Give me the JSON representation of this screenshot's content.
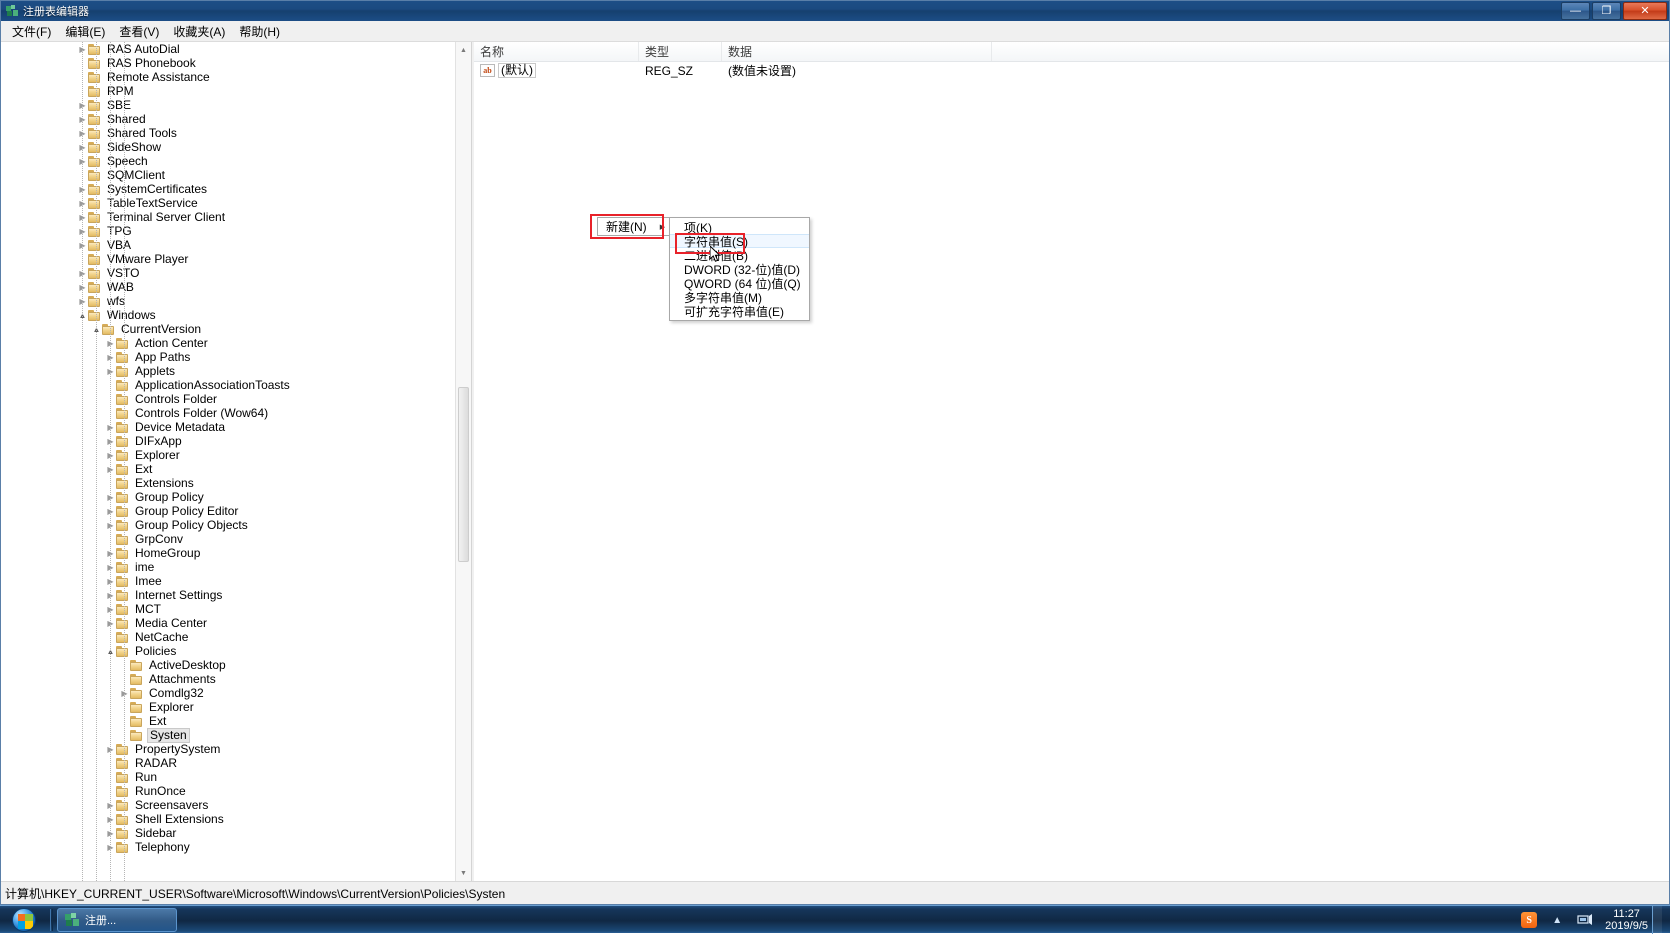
{
  "window": {
    "title": "注册表编辑器",
    "icon": "registry-editor-icon",
    "buttons": {
      "minimize": "—",
      "restore": "❐",
      "close": "✕"
    }
  },
  "menu_bar": {
    "items": [
      {
        "label": "文件(F)",
        "name": "menu-file"
      },
      {
        "label": "编辑(E)",
        "name": "menu-edit"
      },
      {
        "label": "查看(V)",
        "name": "menu-view"
      },
      {
        "label": "收藏夹(A)",
        "name": "menu-favorites"
      },
      {
        "label": "帮助(H)",
        "name": "menu-help"
      }
    ]
  },
  "tree": {
    "items": [
      {
        "label": "RAS AutoDial",
        "depth": 1,
        "state": "collapsed"
      },
      {
        "label": "RAS Phonebook",
        "depth": 1,
        "state": "leaf"
      },
      {
        "label": "Remote Assistance",
        "depth": 1,
        "state": "leaf"
      },
      {
        "label": "RPM",
        "depth": 1,
        "state": "leaf"
      },
      {
        "label": "SBE",
        "depth": 1,
        "state": "collapsed"
      },
      {
        "label": "Shared",
        "depth": 1,
        "state": "collapsed"
      },
      {
        "label": "Shared Tools",
        "depth": 1,
        "state": "collapsed"
      },
      {
        "label": "SideShow",
        "depth": 1,
        "state": "collapsed"
      },
      {
        "label": "Speech",
        "depth": 1,
        "state": "collapsed"
      },
      {
        "label": "SQMClient",
        "depth": 1,
        "state": "leaf"
      },
      {
        "label": "SystemCertificates",
        "depth": 1,
        "state": "collapsed"
      },
      {
        "label": "TableTextService",
        "depth": 1,
        "state": "collapsed"
      },
      {
        "label": "Terminal Server Client",
        "depth": 1,
        "state": "collapsed"
      },
      {
        "label": "TPG",
        "depth": 1,
        "state": "collapsed"
      },
      {
        "label": "VBA",
        "depth": 1,
        "state": "collapsed"
      },
      {
        "label": "VMware Player",
        "depth": 1,
        "state": "leaf"
      },
      {
        "label": "VSTO",
        "depth": 1,
        "state": "collapsed"
      },
      {
        "label": "WAB",
        "depth": 1,
        "state": "collapsed"
      },
      {
        "label": "wfs",
        "depth": 1,
        "state": "collapsed"
      },
      {
        "label": "Windows",
        "depth": 1,
        "state": "expanded"
      },
      {
        "label": "CurrentVersion",
        "depth": 2,
        "state": "expanded"
      },
      {
        "label": "Action Center",
        "depth": 3,
        "state": "collapsed"
      },
      {
        "label": "App Paths",
        "depth": 3,
        "state": "collapsed"
      },
      {
        "label": "Applets",
        "depth": 3,
        "state": "collapsed"
      },
      {
        "label": "ApplicationAssociationToasts",
        "depth": 3,
        "state": "leaf"
      },
      {
        "label": "Controls Folder",
        "depth": 3,
        "state": "leaf"
      },
      {
        "label": "Controls Folder (Wow64)",
        "depth": 3,
        "state": "leaf"
      },
      {
        "label": "Device Metadata",
        "depth": 3,
        "state": "collapsed"
      },
      {
        "label": "DIFxApp",
        "depth": 3,
        "state": "collapsed"
      },
      {
        "label": "Explorer",
        "depth": 3,
        "state": "collapsed"
      },
      {
        "label": "Ext",
        "depth": 3,
        "state": "collapsed"
      },
      {
        "label": "Extensions",
        "depth": 3,
        "state": "leaf"
      },
      {
        "label": "Group Policy",
        "depth": 3,
        "state": "collapsed"
      },
      {
        "label": "Group Policy Editor",
        "depth": 3,
        "state": "collapsed"
      },
      {
        "label": "Group Policy Objects",
        "depth": 3,
        "state": "collapsed"
      },
      {
        "label": "GrpConv",
        "depth": 3,
        "state": "leaf"
      },
      {
        "label": "HomeGroup",
        "depth": 3,
        "state": "collapsed"
      },
      {
        "label": "ime",
        "depth": 3,
        "state": "collapsed"
      },
      {
        "label": "Imee",
        "depth": 3,
        "state": "collapsed"
      },
      {
        "label": "Internet Settings",
        "depth": 3,
        "state": "collapsed"
      },
      {
        "label": "MCT",
        "depth": 3,
        "state": "collapsed"
      },
      {
        "label": "Media Center",
        "depth": 3,
        "state": "collapsed"
      },
      {
        "label": "NetCache",
        "depth": 3,
        "state": "leaf"
      },
      {
        "label": "Policies",
        "depth": 3,
        "state": "expanded"
      },
      {
        "label": "ActiveDesktop",
        "depth": 4,
        "state": "leaf"
      },
      {
        "label": "Attachments",
        "depth": 4,
        "state": "leaf"
      },
      {
        "label": "Comdlg32",
        "depth": 4,
        "state": "collapsed"
      },
      {
        "label": "Explorer",
        "depth": 4,
        "state": "leaf"
      },
      {
        "label": "Ext",
        "depth": 4,
        "state": "leaf"
      },
      {
        "label": "Systen",
        "depth": 4,
        "state": "leaf",
        "selected": true
      },
      {
        "label": "PropertySystem",
        "depth": 3,
        "state": "collapsed"
      },
      {
        "label": "RADAR",
        "depth": 3,
        "state": "leaf"
      },
      {
        "label": "Run",
        "depth": 3,
        "state": "leaf"
      },
      {
        "label": "RunOnce",
        "depth": 3,
        "state": "leaf"
      },
      {
        "label": "Screensavers",
        "depth": 3,
        "state": "collapsed"
      },
      {
        "label": "Shell Extensions",
        "depth": 3,
        "state": "collapsed"
      },
      {
        "label": "Sidebar",
        "depth": 3,
        "state": "collapsed"
      },
      {
        "label": "Telephony",
        "depth": 3,
        "state": "collapsed"
      }
    ],
    "scrollbar": {
      "up_arrow": "▲",
      "down_arrow": "▼"
    }
  },
  "value_list": {
    "columns": [
      {
        "label": "名称",
        "name": "column-name"
      },
      {
        "label": "类型",
        "name": "column-type"
      },
      {
        "label": "数据",
        "name": "column-data"
      }
    ],
    "rows": [
      {
        "icon": "string-value-icon",
        "icon_text": "ab",
        "name": "(默认)",
        "type": "REG_SZ",
        "data": "(数值未设置)"
      }
    ]
  },
  "context_menu": {
    "new_label": "新建(N)",
    "submenu_arrow": "▶",
    "submenu": [
      {
        "label": "项(K)",
        "name": "new-key"
      },
      {
        "label": "字符串值(S)",
        "name": "new-string-value",
        "highlighted": true
      },
      {
        "label": "二进制值(B)",
        "name": "new-binary-value"
      },
      {
        "label": "DWORD (32-位)值(D)",
        "name": "new-dword-value"
      },
      {
        "label": "QWORD (64 位)值(Q)",
        "name": "new-qword-value"
      },
      {
        "label": "多字符串值(M)",
        "name": "new-multi-string-value"
      },
      {
        "label": "可扩充字符串值(E)",
        "name": "new-expandable-string-value"
      }
    ]
  },
  "status_bar": {
    "path": "计算机\\HKEY_CURRENT_USER\\Software\\Microsoft\\Windows\\CurrentVersion\\Policies\\Systen"
  },
  "taskbar": {
    "start_label": "start-orb",
    "items": [
      {
        "label": "注册...",
        "icon": "registry-editor-icon",
        "name": "taskbar-item-regedit"
      }
    ],
    "tray": {
      "ime_label": "S",
      "show_hidden_arrow": "▲",
      "network_icon": "network-icon"
    },
    "clock": {
      "time": "11:27",
      "date": "2019/9/5"
    }
  },
  "annotations": {
    "accent_color": "#e8222a",
    "boxes": [
      {
        "name": "annotation-new-menu"
      },
      {
        "name": "annotation-string-value"
      }
    ]
  }
}
